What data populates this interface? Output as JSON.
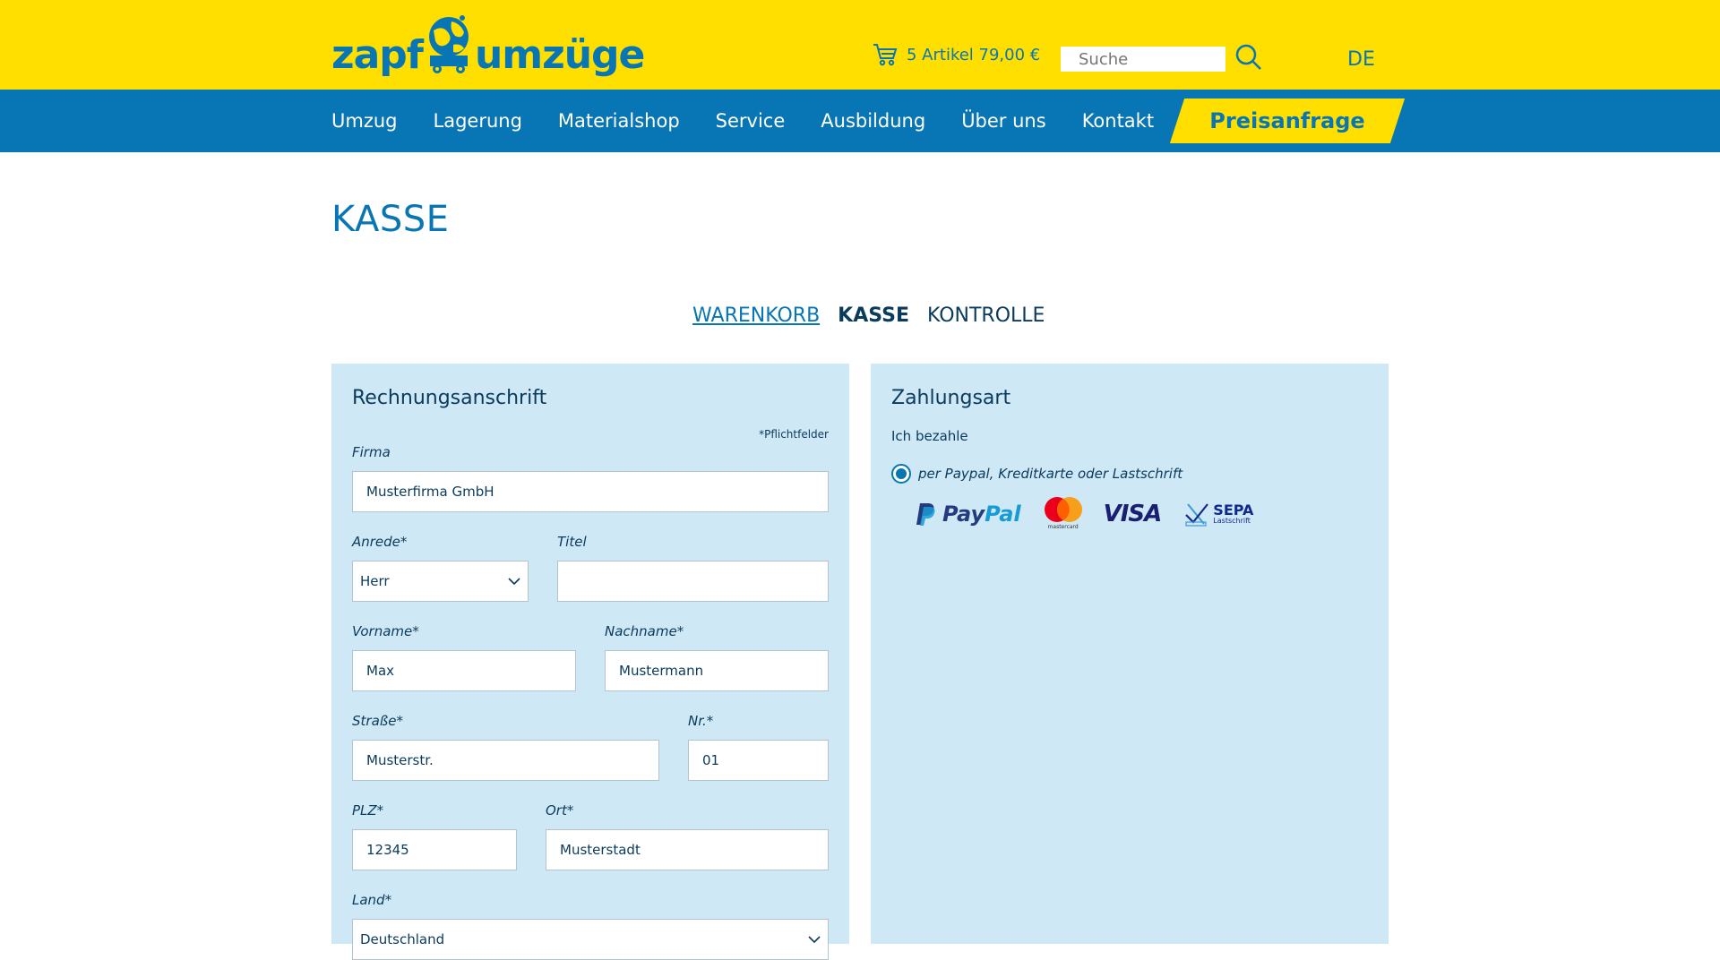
{
  "header": {
    "logo_left": "zapf",
    "logo_right": "umzüge",
    "cart_text": "5 Artikel 79,00 €",
    "search_placeholder": "Suche",
    "language": "DE"
  },
  "nav": {
    "items": [
      "Umzug",
      "Lagerung",
      "Materialshop",
      "Service",
      "Ausbildung",
      "Über uns",
      "Kontakt"
    ],
    "cta": "Preisanfrage"
  },
  "page": {
    "title": "KASSE"
  },
  "steps": {
    "cart": "WARENKORB",
    "checkout": "KASSE",
    "review": "KONTROLLE"
  },
  "billing": {
    "title": "Rechnungsanschrift",
    "required_note": "*Pflichtfelder",
    "company_label": "Firma",
    "company_value": "Musterfirma GmbH",
    "salutation_label": "Anrede*",
    "salutation_value": "Herr",
    "title_label": "Titel",
    "title_value": "",
    "firstname_label": "Vorname*",
    "firstname_value": "Max",
    "lastname_label": "Nachname*",
    "lastname_value": "Mustermann",
    "street_label": "Straße*",
    "street_value": "Musterstr.",
    "number_label": "Nr.*",
    "number_value": "01",
    "zip_label": "PLZ*",
    "zip_value": "12345",
    "city_label": "Ort*",
    "city_value": "Musterstadt",
    "country_label": "Land*",
    "country_value": "Deutschland"
  },
  "payment": {
    "title": "Zahlungsart",
    "lead": "Ich bezahle",
    "option_label": "per Paypal, Kreditkarte oder Lastschrift",
    "paypal_a": "Pay",
    "paypal_b": "Pal",
    "mastercard_text": "mastercard",
    "visa": "VISA",
    "sepa": "SEPA",
    "sepa_sub": "Lastschrift"
  },
  "colors": {
    "brand_yellow": "#ffdf00",
    "brand_blue": "#0876b5",
    "panel_bg": "#cfe8f6",
    "text_dark": "#0a3a5c"
  }
}
